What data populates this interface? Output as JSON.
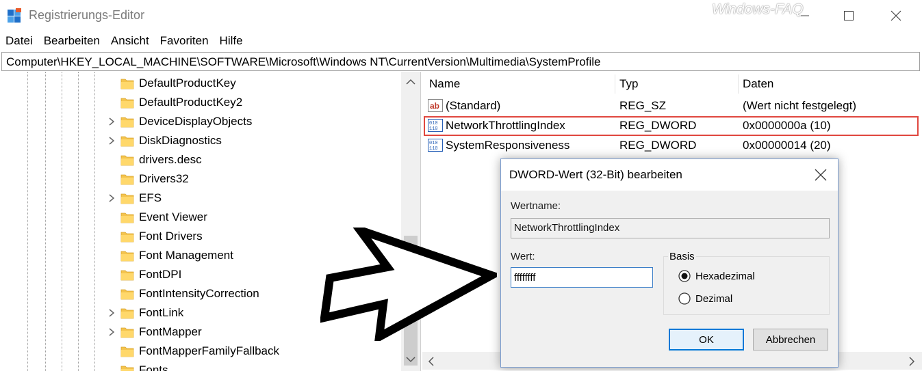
{
  "window": {
    "title": "Registrierungs-Editor",
    "watermark": "Windows-FAQ"
  },
  "menu": [
    "Datei",
    "Bearbeiten",
    "Ansicht",
    "Favoriten",
    "Hilfe"
  ],
  "address": "Computer\\HKEY_LOCAL_MACHINE\\SOFTWARE\\Microsoft\\Windows NT\\CurrentVersion\\Multimedia\\SystemProfile",
  "tree": {
    "items": [
      {
        "label": "DefaultProductKey",
        "expandable": false
      },
      {
        "label": "DefaultProductKey2",
        "expandable": false
      },
      {
        "label": "DeviceDisplayObjects",
        "expandable": true
      },
      {
        "label": "DiskDiagnostics",
        "expandable": true
      },
      {
        "label": "drivers.desc",
        "expandable": false
      },
      {
        "label": "Drivers32",
        "expandable": false
      },
      {
        "label": "EFS",
        "expandable": true
      },
      {
        "label": "Event Viewer",
        "expandable": false
      },
      {
        "label": "Font Drivers",
        "expandable": false
      },
      {
        "label": "Font Management",
        "expandable": false
      },
      {
        "label": "FontDPI",
        "expandable": false
      },
      {
        "label": "FontIntensityCorrection",
        "expandable": false
      },
      {
        "label": "FontLink",
        "expandable": true
      },
      {
        "label": "FontMapper",
        "expandable": true
      },
      {
        "label": "FontMapperFamilyFallback",
        "expandable": false
      },
      {
        "label": "Fonts",
        "expandable": false
      }
    ]
  },
  "list": {
    "columns": [
      "Name",
      "Typ",
      "Daten"
    ],
    "rows": [
      {
        "name": "(Standard)",
        "type": "REG_SZ",
        "data": "(Wert nicht festgelegt)",
        "icon": "string-value-icon"
      },
      {
        "name": "NetworkThrottlingIndex",
        "type": "REG_DWORD",
        "data": "0x0000000a (10)",
        "icon": "binary-value-icon",
        "highlighted": true
      },
      {
        "name": "SystemResponsiveness",
        "type": "REG_DWORD",
        "data": "0x00000014 (20)",
        "icon": "binary-value-icon"
      }
    ]
  },
  "dialog": {
    "title": "DWORD-Wert (32-Bit) bearbeiten",
    "name_label": "Wertname:",
    "name_value": "NetworkThrottlingIndex",
    "value_label": "Wert:",
    "value": "ffffffff",
    "basis_label": "Basis",
    "radio_hex": "Hexadezimal",
    "radio_dec": "Dezimal",
    "selected_basis": "Hexadezimal",
    "ok": "OK",
    "cancel": "Abbrechen"
  },
  "colors": {
    "highlight": "#e0473f",
    "folder": "#f4c44e",
    "accent": "#0078d7"
  }
}
